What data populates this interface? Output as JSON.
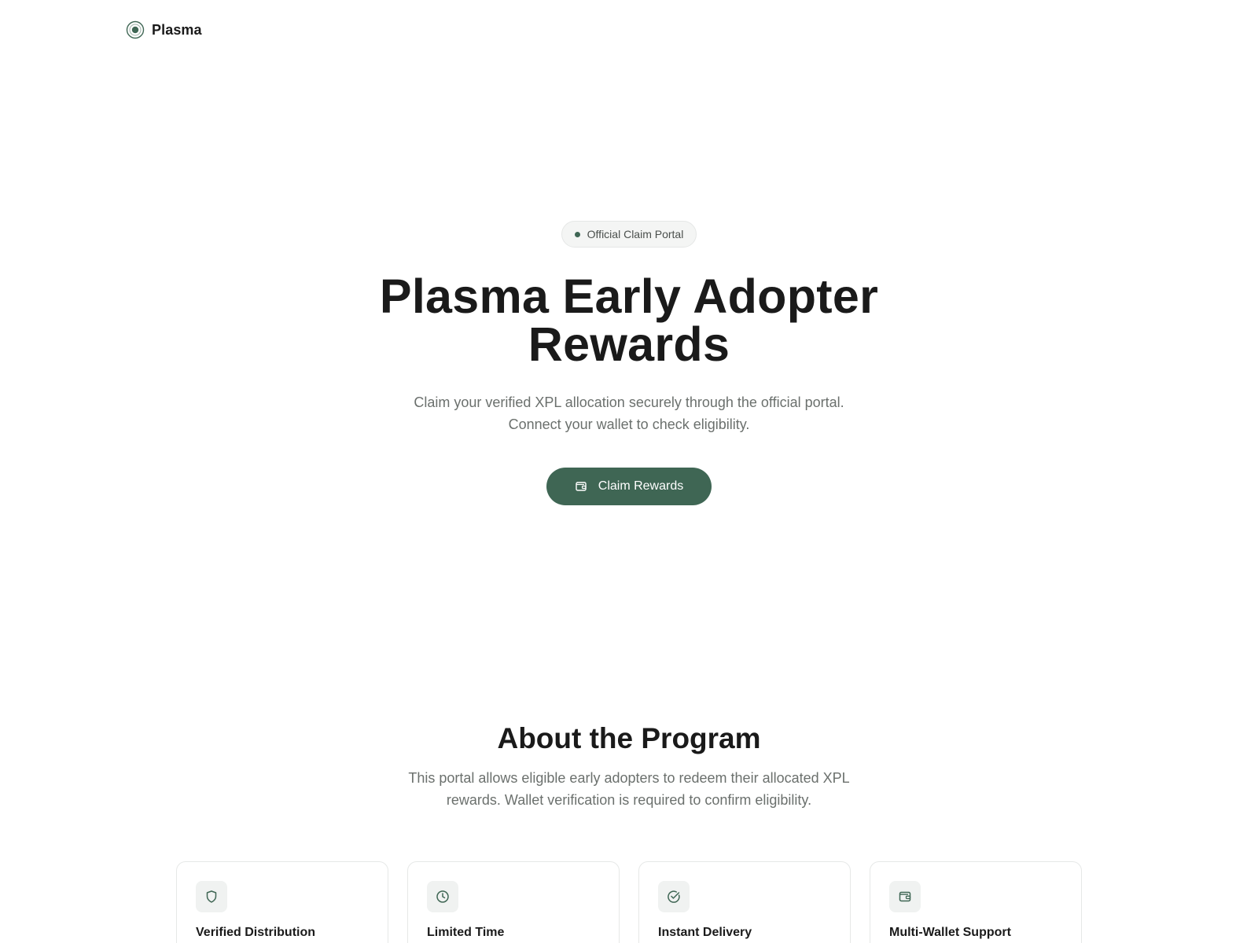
{
  "header": {
    "brand_name": "Plasma",
    "logo_icon": "concentric-circle-icon"
  },
  "hero": {
    "badge_label": "Official Claim Portal",
    "title": "Plasma Early Adopter Rewards",
    "subtitle": "Claim your verified XPL allocation securely through the official portal. Connect your wallet to check eligibility.",
    "cta_label": "Claim Rewards",
    "cta_icon": "wallet-icon"
  },
  "about": {
    "title": "About the Program",
    "text": "This portal allows eligible early adopters to redeem their allocated XPL rewards. Wallet verification is required to confirm eligibility.",
    "features": [
      {
        "icon": "shield-icon",
        "title": "Verified Distribution"
      },
      {
        "icon": "clock-icon",
        "title": "Limited Time"
      },
      {
        "icon": "check-circle-icon",
        "title": "Instant Delivery"
      },
      {
        "icon": "wallet-icon",
        "title": "Multi-Wallet Support"
      }
    ]
  },
  "colors": {
    "accent": "#3f6654",
    "text": "#1a1a1a",
    "muted": "#6b706d",
    "badge_bg": "#f4f5f4",
    "card_border": "#e6e8e7"
  }
}
